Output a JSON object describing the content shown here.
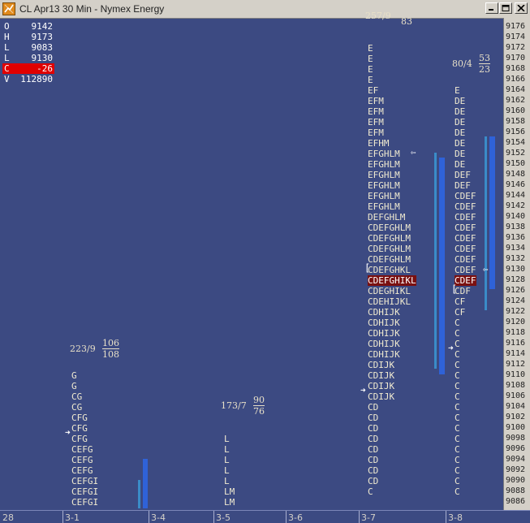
{
  "window": {
    "title": "CL Apr13 30 Min - Nymex Energy",
    "icon": "chart-app-icon",
    "controls": [
      "minimize-icon",
      "maximize-icon",
      "close-icon"
    ]
  },
  "ohlc": [
    {
      "key": "O",
      "value": "9142",
      "negative": false
    },
    {
      "key": "H",
      "value": "9173",
      "negative": false
    },
    {
      "key": "L",
      "value": "9083",
      "negative": false
    },
    {
      "key": "L",
      "value": "9130",
      "negative": false
    },
    {
      "key": "C",
      "value": "-26",
      "negative": true
    },
    {
      "key": "V",
      "value": "112890",
      "negative": false
    }
  ],
  "price_axis": [
    "9176",
    "9174",
    "9172",
    "9170",
    "9168",
    "9166",
    "9164",
    "9162",
    "9160",
    "9158",
    "9156",
    "9154",
    "9152",
    "9150",
    "9148",
    "9146",
    "9144",
    "9142",
    "9140",
    "9138",
    "9136",
    "9134",
    "9132",
    "9130",
    "9128",
    "9126",
    "9124",
    "9122",
    "9120",
    "9118",
    "9116",
    "9114",
    "9112",
    "9110",
    "9108",
    "9106",
    "9104",
    "9102",
    "9100",
    "9098",
    "9096",
    "9094",
    "9092",
    "9090",
    "9088",
    "9086"
  ],
  "date_axis": [
    {
      "label": "28"
    },
    {
      "label": "3-1"
    },
    {
      "label": "3-4"
    },
    {
      "label": "3-5"
    },
    {
      "label": "3-6"
    },
    {
      "label": "3-7"
    },
    {
      "label": "3-8"
    }
  ],
  "profiles": [
    {
      "name": "3-1",
      "info": "223/9",
      "frac_num": "106",
      "frac_den": "108",
      "rows": [
        {
          "price": "9110",
          "text": "G"
        },
        {
          "price": "9108",
          "text": "G"
        },
        {
          "price": "9106",
          "text": "CG"
        },
        {
          "price": "9104",
          "text": "CG"
        },
        {
          "price": "9102",
          "text": "CFG"
        },
        {
          "price": "9100",
          "text": "CFG"
        },
        {
          "price": "9098",
          "text": "CFG"
        },
        {
          "price": "9096",
          "text": "CEFG"
        },
        {
          "price": "9094",
          "text": "CEFG"
        },
        {
          "price": "9092",
          "text": "CEFG"
        },
        {
          "price": "9090",
          "text": "CEFGI"
        },
        {
          "price": "9088",
          "text": "CEFGI"
        },
        {
          "price": "9086",
          "text": "CEFGI"
        },
        {
          "price": "9084",
          "text": "CEFGI"
        }
      ]
    },
    {
      "name": "3-5",
      "info": "173/7",
      "frac_num": "90",
      "frac_den": "76",
      "rows": [
        {
          "price": "9098",
          "text": "L"
        },
        {
          "price": "9096",
          "text": "L"
        },
        {
          "price": "9094",
          "text": "L"
        },
        {
          "price": "9092",
          "text": "L"
        },
        {
          "price": "9090",
          "text": "L"
        },
        {
          "price": "9088",
          "text": "LM"
        },
        {
          "price": "9086",
          "text": "LM"
        },
        {
          "price": "9084",
          "text": "LM"
        }
      ]
    },
    {
      "name": "3-7",
      "info": "257/9",
      "frac_num": "83",
      "frac_den": "",
      "rows": [
        {
          "price": "9172",
          "text": "E"
        },
        {
          "price": "9170",
          "text": "E"
        },
        {
          "price": "9168",
          "text": "E"
        },
        {
          "price": "9166",
          "text": "E"
        },
        {
          "price": "9164",
          "text": "EF"
        },
        {
          "price": "9162",
          "text": "EFM"
        },
        {
          "price": "9160",
          "text": "EFM"
        },
        {
          "price": "9158",
          "text": "EFM"
        },
        {
          "price": "9156",
          "text": "EFM"
        },
        {
          "price": "9154",
          "text": "EFHM"
        },
        {
          "price": "9152",
          "text": "EFGHLM"
        },
        {
          "price": "9150",
          "text": "EFGHLM"
        },
        {
          "price": "9148",
          "text": "EFGHLM"
        },
        {
          "price": "9146",
          "text": "EFGHLM"
        },
        {
          "price": "9144",
          "text": "EFGHLM"
        },
        {
          "price": "9142",
          "text": "EFGHLM"
        },
        {
          "price": "9140",
          "text": "DEFGHLM"
        },
        {
          "price": "9138",
          "text": "CDEFGHLM"
        },
        {
          "price": "9136",
          "text": "CDEFGHLM"
        },
        {
          "price": "9134",
          "text": "CDEFGHLM"
        },
        {
          "price": "9132",
          "text": "CDEFGHLM"
        },
        {
          "price": "9130",
          "text": "CDEFGHKL"
        },
        {
          "price": "9128",
          "text": "CDEFGHIKL",
          "poc": true
        },
        {
          "price": "9126",
          "text": "CDEGHIKL"
        },
        {
          "price": "9124",
          "text": "CDEHIJKL"
        },
        {
          "price": "9122",
          "text": "CDHIJK"
        },
        {
          "price": "9120",
          "text": "CDHIJK"
        },
        {
          "price": "9118",
          "text": "CDHIJK"
        },
        {
          "price": "9116",
          "text": "CDHIJK"
        },
        {
          "price": "9114",
          "text": "CDHIJK"
        },
        {
          "price": "9112",
          "text": "CDIJK"
        },
        {
          "price": "9110",
          "text": "CDIJK"
        },
        {
          "price": "9108",
          "text": "CDIJK"
        },
        {
          "price": "9106",
          "text": "CDIJK"
        },
        {
          "price": "9104",
          "text": "CD"
        },
        {
          "price": "9102",
          "text": "CD"
        },
        {
          "price": "9100",
          "text": "CD"
        },
        {
          "price": "9098",
          "text": "CD"
        },
        {
          "price": "9096",
          "text": "CD"
        },
        {
          "price": "9094",
          "text": "CD"
        },
        {
          "price": "9092",
          "text": "CD"
        },
        {
          "price": "9090",
          "text": "CD"
        },
        {
          "price": "9088",
          "text": "C"
        }
      ]
    },
    {
      "name": "3-8",
      "info": "80/4",
      "frac_num": "53",
      "frac_den": "23",
      "rows": [
        {
          "price": "9164",
          "text": "E"
        },
        {
          "price": "9162",
          "text": "DE"
        },
        {
          "price": "9160",
          "text": "DE"
        },
        {
          "price": "9158",
          "text": "DE"
        },
        {
          "price": "9156",
          "text": "DE"
        },
        {
          "price": "9154",
          "text": "DE"
        },
        {
          "price": "9152",
          "text": "DE"
        },
        {
          "price": "9150",
          "text": "DE"
        },
        {
          "price": "9148",
          "text": "DEF"
        },
        {
          "price": "9146",
          "text": "DEF"
        },
        {
          "price": "9144",
          "text": "CDEF"
        },
        {
          "price": "9142",
          "text": "CDEF"
        },
        {
          "price": "9140",
          "text": "CDEF"
        },
        {
          "price": "9138",
          "text": "CDEF"
        },
        {
          "price": "9136",
          "text": "CDEF"
        },
        {
          "price": "9134",
          "text": "CDEF"
        },
        {
          "price": "9132",
          "text": "CDEF"
        },
        {
          "price": "9130",
          "text": "CDEF"
        },
        {
          "price": "9128",
          "text": "CDEF",
          "poc": true
        },
        {
          "price": "9126",
          "text": "CDF"
        },
        {
          "price": "9124",
          "text": "CF"
        },
        {
          "price": "9122",
          "text": "CF"
        },
        {
          "price": "9120",
          "text": "C"
        },
        {
          "price": "9118",
          "text": "C"
        },
        {
          "price": "9116",
          "text": "C"
        },
        {
          "price": "9114",
          "text": "C"
        },
        {
          "price": "9112",
          "text": "C"
        },
        {
          "price": "9110",
          "text": "C"
        },
        {
          "price": "9108",
          "text": "C"
        },
        {
          "price": "9106",
          "text": "C"
        },
        {
          "price": "9104",
          "text": "C"
        },
        {
          "price": "9102",
          "text": "C"
        },
        {
          "price": "9100",
          "text": "C"
        },
        {
          "price": "9098",
          "text": "C"
        },
        {
          "price": "9096",
          "text": "C"
        },
        {
          "price": "9094",
          "text": "C"
        },
        {
          "price": "9092",
          "text": "C"
        },
        {
          "price": "9090",
          "text": "C"
        },
        {
          "price": "9088",
          "text": "C"
        }
      ]
    }
  ],
  "colors": {
    "background": "#3c4a82",
    "tpo_text": "#f0ead0",
    "poc_highlight": "#7a1010",
    "value_area_bar": "#2f62d8",
    "value_area_bar_light": "#3a8cc8",
    "negative_change": "#e00000"
  }
}
